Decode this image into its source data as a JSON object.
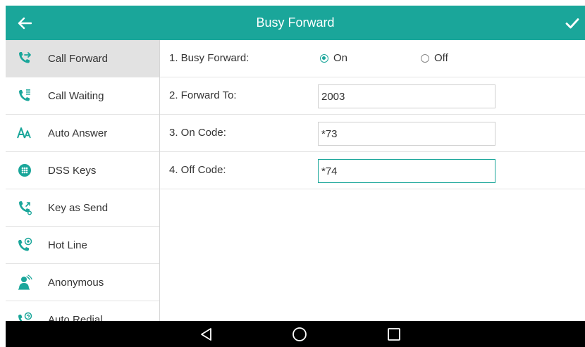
{
  "header": {
    "title": "Busy Forward",
    "back_icon": "arrow-left-icon",
    "confirm_icon": "checkmark-icon",
    "color": "#1aa69a"
  },
  "sidebar": {
    "items": [
      {
        "label": "Call Forward",
        "icon": "call-forward-icon",
        "active": true
      },
      {
        "label": "Call Waiting",
        "icon": "call-waiting-icon",
        "active": false
      },
      {
        "label": "Auto Answer",
        "icon": "auto-answer-icon",
        "active": false
      },
      {
        "label": "DSS Keys",
        "icon": "dss-keys-icon",
        "active": false
      },
      {
        "label": "Key as Send",
        "icon": "key-as-send-icon",
        "active": false
      },
      {
        "label": "Hot Line",
        "icon": "hot-line-icon",
        "active": false
      },
      {
        "label": "Anonymous",
        "icon": "anonymous-icon",
        "active": false
      },
      {
        "label": "Auto Redial",
        "icon": "auto-redial-icon",
        "active": false
      }
    ]
  },
  "form": {
    "busy_forward": {
      "label": "1. Busy Forward:",
      "option_on": "On",
      "option_off": "Off",
      "selected": "On"
    },
    "forward_to": {
      "label": "2. Forward To:",
      "value": "2003"
    },
    "on_code": {
      "label": "3. On Code:",
      "value": "*73"
    },
    "off_code": {
      "label": "4. Off Code:",
      "value": "*74"
    }
  },
  "navbar": {
    "back_icon": "triangle-back-icon",
    "home_icon": "circle-home-icon",
    "recents_icon": "square-recents-icon"
  }
}
